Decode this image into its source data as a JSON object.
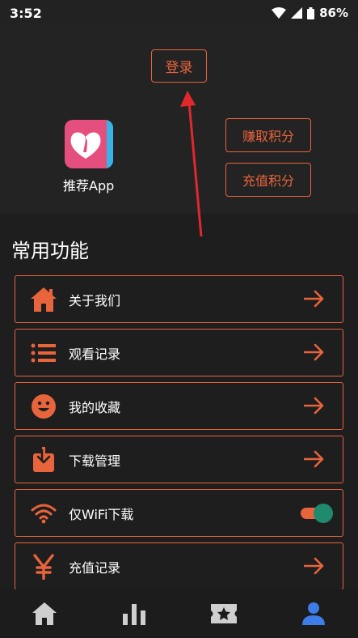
{
  "status_bar": {
    "time": "3:52",
    "battery": "86%"
  },
  "header": {
    "login_label": "登录",
    "app_name": "推荐App",
    "earn_points_label": "赚取积分",
    "recharge_points_label": "充值积分"
  },
  "section": {
    "title": "常用功能"
  },
  "menu": {
    "items": [
      {
        "label": "关于我们",
        "icon": "home-icon"
      },
      {
        "label": "观看记录",
        "icon": "list-icon"
      },
      {
        "label": "我的收藏",
        "icon": "smiley-icon"
      },
      {
        "label": "下载管理",
        "icon": "download-icon"
      },
      {
        "label": "仅WiFi下载",
        "icon": "wifi-icon",
        "toggle": true
      },
      {
        "label": "充值记录",
        "icon": "yen-icon"
      }
    ]
  },
  "bottom_nav": {
    "items": [
      "home-icon",
      "chart-icon",
      "ticket-icon",
      "profile-icon"
    ],
    "active_index": 3
  },
  "colors": {
    "accent": "#e8643c",
    "active_nav": "#3d7de8",
    "inactive_nav": "#cfcfcf",
    "toggle_knob": "#1f8a6d"
  }
}
